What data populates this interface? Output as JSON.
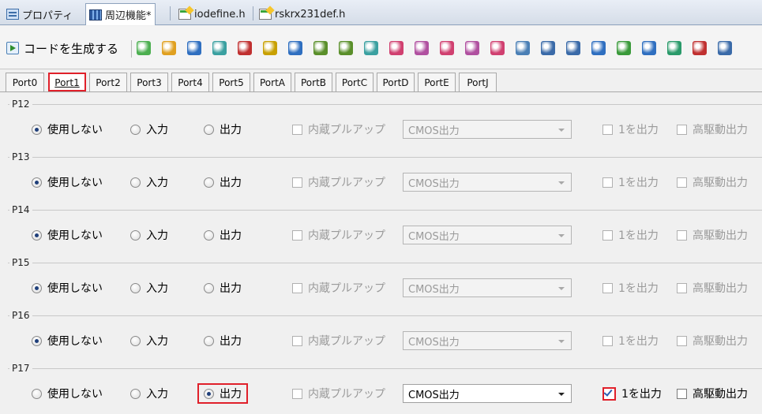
{
  "doc_tabs": [
    {
      "label": "プロパティ",
      "icon": "properties-icon"
    },
    {
      "label": "周辺機能*",
      "icon": "peripheral-icon"
    },
    {
      "label": "iodefine.h",
      "icon": "header-file-icon"
    },
    {
      "label": "rskrx231def.h",
      "icon": "header-file-icon"
    }
  ],
  "toolbar": {
    "generate_label": "コードを生成する",
    "icons": [
      "port-icon",
      "module-icon",
      "clock-icon",
      "chart-icon",
      "pin-icon",
      "chip-icon",
      "dma-icon",
      "timer-icon",
      "timer2-icon",
      "mtu-icon",
      "watch-icon",
      "watch2-icon",
      "watch3-icon",
      "watch4-icon",
      "watch5-icon",
      "table-icon",
      "link-icon",
      "link2-icon",
      "signal-icon",
      "adc-icon",
      "signal2-icon",
      "filter-icon",
      "comm-icon",
      "power-icon"
    ]
  },
  "port_tabs": [
    "Port0",
    "Port1",
    "Port2",
    "Port3",
    "Port4",
    "Port5",
    "PortA",
    "PortB",
    "PortC",
    "PortD",
    "PortE",
    "PortJ"
  ],
  "active_port_tab": "Port1",
  "labels": {
    "unused": "使用しない",
    "input": "入力",
    "output": "出力",
    "pullup": "内蔵プルアップ",
    "select_value": "CMOS出力",
    "output1": "1を出力",
    "high_drive": "高駆動出力"
  },
  "pins": [
    {
      "name": "P12",
      "mode": "unused",
      "output1": false
    },
    {
      "name": "P13",
      "mode": "unused",
      "output1": false
    },
    {
      "name": "P14",
      "mode": "unused",
      "output1": false
    },
    {
      "name": "P15",
      "mode": "unused",
      "output1": false
    },
    {
      "name": "P16",
      "mode": "unused",
      "output1": false
    },
    {
      "name": "P17",
      "mode": "output",
      "output1": true
    }
  ],
  "colors": {
    "highlight": "#e0202a",
    "accent": "#1f3f7a"
  }
}
